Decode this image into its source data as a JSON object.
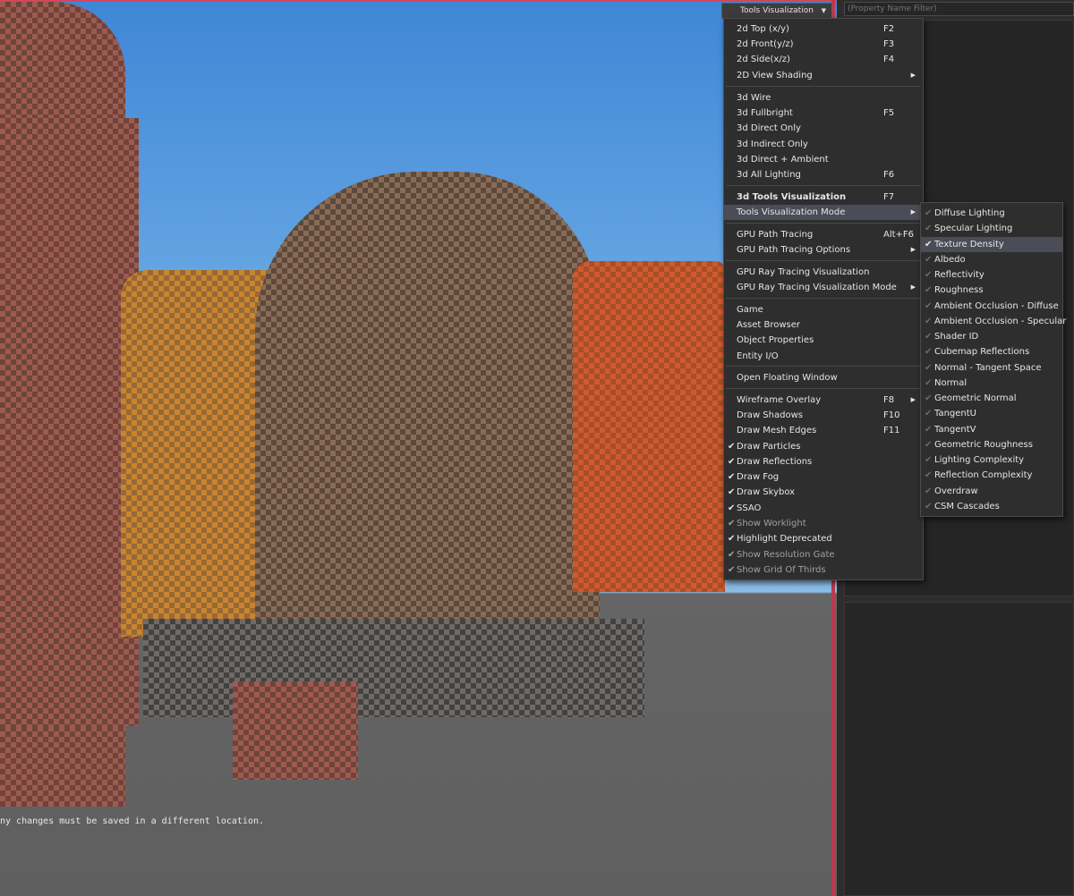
{
  "viewport": {
    "mode_dropdown_label": "Tools Visualization",
    "console_message": "ny changes must be saved in a different location."
  },
  "property_panel": {
    "filter_placeholder": "(Property Name Filter)"
  },
  "main_menu": {
    "items": [
      {
        "label": "2d Top (x/y)",
        "shortcut": "F2"
      },
      {
        "label": "2d Front(y/z)",
        "shortcut": "F3"
      },
      {
        "label": "2d Side(x/z)",
        "shortcut": "F4"
      },
      {
        "label": "2D View Shading",
        "shortcut": ""
      },
      {
        "label": "3d Wire",
        "shortcut": ""
      },
      {
        "label": "3d Fullbright",
        "shortcut": "F5"
      },
      {
        "label": "3d Direct Only",
        "shortcut": ""
      },
      {
        "label": "3d Indirect Only",
        "shortcut": ""
      },
      {
        "label": "3d Direct + Ambient",
        "shortcut": ""
      },
      {
        "label": "3d All Lighting",
        "shortcut": "F6"
      },
      {
        "label": "3d Tools Visualization",
        "shortcut": "F7"
      },
      {
        "label": "Tools Visualization Mode",
        "shortcut": ""
      },
      {
        "label": "GPU Path Tracing",
        "shortcut": "Alt+F6"
      },
      {
        "label": "GPU Path Tracing Options",
        "shortcut": ""
      },
      {
        "label": "GPU Ray Tracing Visualization",
        "shortcut": ""
      },
      {
        "label": "GPU Ray Tracing Visualization Mode",
        "shortcut": ""
      },
      {
        "label": "Game",
        "shortcut": ""
      },
      {
        "label": "Asset Browser",
        "shortcut": ""
      },
      {
        "label": "Object Properties",
        "shortcut": ""
      },
      {
        "label": "Entity I/O",
        "shortcut": ""
      },
      {
        "label": "Open Floating Window",
        "shortcut": ""
      },
      {
        "label": "Wireframe Overlay",
        "shortcut": "F8"
      },
      {
        "label": "Draw Shadows",
        "shortcut": "F10"
      },
      {
        "label": "Draw Mesh Edges",
        "shortcut": "F11"
      },
      {
        "label": "Draw Particles",
        "shortcut": ""
      },
      {
        "label": "Draw Reflections",
        "shortcut": ""
      },
      {
        "label": "Draw Fog",
        "shortcut": ""
      },
      {
        "label": "Draw Skybox",
        "shortcut": ""
      },
      {
        "label": "SSAO",
        "shortcut": ""
      },
      {
        "label": "Show Worklight",
        "shortcut": ""
      },
      {
        "label": "Highlight Deprecated",
        "shortcut": ""
      },
      {
        "label": "Show Resolution Gate",
        "shortcut": ""
      },
      {
        "label": "Show Grid Of Thirds",
        "shortcut": ""
      }
    ],
    "checked": [
      "Draw Particles",
      "Draw Reflections",
      "Draw Fog",
      "Draw Skybox",
      "SSAO",
      "Show Worklight",
      "Highlight Deprecated",
      "Show Resolution Gate",
      "Show Grid Of Thirds"
    ],
    "bold_item": "3d Tools Visualization",
    "highlighted_item": "Tools Visualization Mode"
  },
  "submenu": {
    "items": [
      "Diffuse Lighting",
      "Specular Lighting",
      "Texture Density",
      "Albedo",
      "Reflectivity",
      "Roughness",
      "Ambient Occlusion - Diffuse",
      "Ambient Occlusion - Specular",
      "Shader ID",
      "Cubemap Reflections",
      "Normal - Tangent Space",
      "Normal",
      "Geometric Normal",
      "TangentU",
      "TangentV",
      "Geometric Roughness",
      "Lighting Complexity",
      "Reflection Complexity",
      "Overdraw",
      "CSM Cascades"
    ],
    "selected": "Texture Density"
  },
  "icons": {
    "check": "checkmark-icon",
    "submenu_arrow": "chevron-right-icon",
    "dropdown": "chevron-down-icon"
  },
  "colors": {
    "accent_border": "#b83a4d",
    "menu_bg": "#2e2e2e",
    "highlight_bg": "#4a4d57"
  }
}
